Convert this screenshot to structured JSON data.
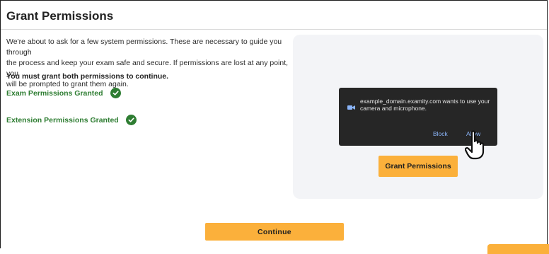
{
  "page": {
    "title": "Grant Permissions",
    "intro_lines": [
      "We're about to ask for a few system permissions. These are necessary to guide you through",
      "the process and keep your exam safe and secure. If permissions are lost at any point, you",
      "will be prompted to grant them again."
    ],
    "requirement": "You must grant both permissions to continue."
  },
  "statuses": [
    {
      "label": "Exam Permissions Granted",
      "icon": "check-circle-icon"
    },
    {
      "label": "Extension Permissions Granted",
      "icon": "check-circle-icon"
    }
  ],
  "illustration": {
    "dialog_message": "example_domain.examity.com wants to use your camera and microphone.",
    "block_label": "Block",
    "allow_label": "Allow",
    "grant_button_label": "Grant Permissions",
    "icons": [
      "camera-icon",
      "pointer-hand-icon"
    ]
  },
  "footer": {
    "continue_label": "Continue"
  },
  "colors": {
    "accent": "#fbb03b",
    "success": "#2e7d32",
    "dialog_bg": "#262626",
    "dialog_link": "#8ab4f8",
    "panel_bg": "#f3f4f7"
  }
}
